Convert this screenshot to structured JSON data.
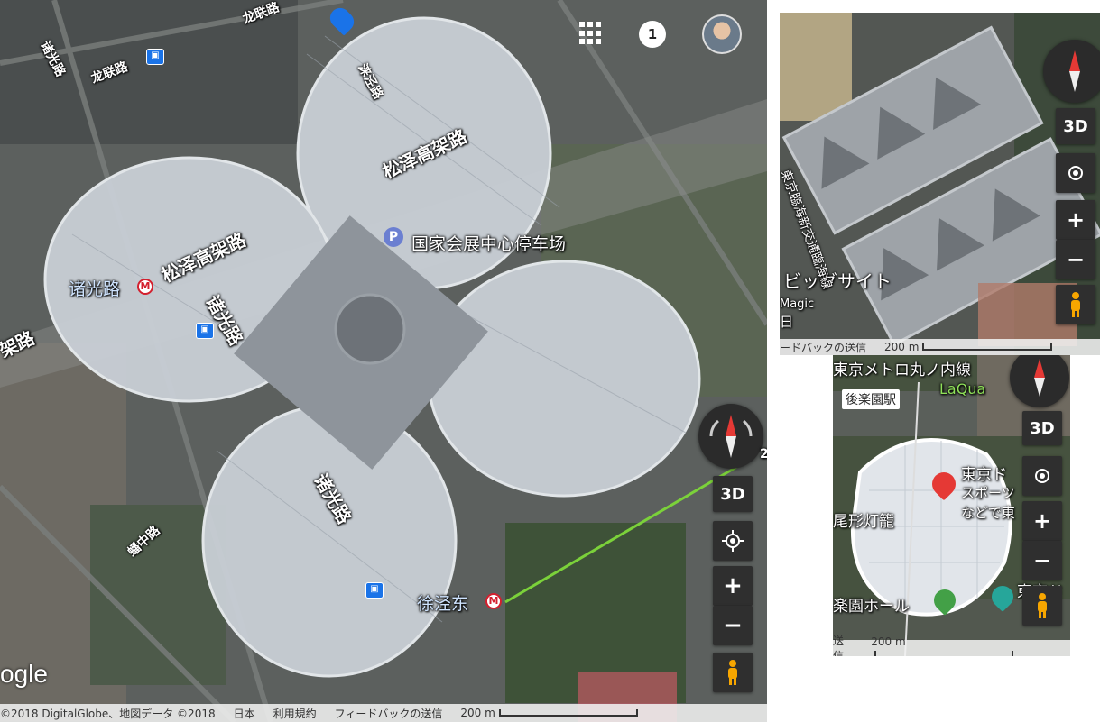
{
  "main": {
    "roads": {
      "songze_1": "松泽高架路",
      "songze_2": "松泽高架路",
      "zhuguang_1": "诸光路",
      "zhuguang_2": "诸光路",
      "zhuguang_3": "诸光路",
      "longlian_1": "龙联路",
      "longlian_2": "龙联路",
      "shenjing": "涞泾路",
      "yingzhong": "蟠中路",
      "jialu": "架路"
    },
    "pois": {
      "parking": "国家会展中心停车场",
      "parking_pin": "P",
      "metro_zhuguang": "诸光路",
      "metro_xujing": "徐泾东"
    },
    "top": {
      "notification_count": "1"
    },
    "controls": {
      "three_d": "3D",
      "zoom_in": "+",
      "zoom_out": "−"
    },
    "edge_label": "2",
    "google_logo": "ogle",
    "footer": {
      "copyright": "©2018 DigitalGlobe、地図データ ©2018",
      "country": "日本",
      "terms": "利用規約",
      "feedback": "フィードバックの送信",
      "scale": "200 m"
    }
  },
  "inset_a": {
    "labels": {
      "big_sight": "ビッグサイト",
      "road_v": "東京臨海新交通臨海線",
      "magic": "Magic",
      "nichi": "日"
    },
    "controls": {
      "three_d": "3D",
      "zoom_in": "+",
      "zoom_out": "−"
    },
    "footer": {
      "feedback": "ードバックの送信",
      "scale": "200 m"
    }
  },
  "inset_b": {
    "labels": {
      "metro_line": "東京メトロ丸ノ内線",
      "laqua": "LaQua",
      "station": "後楽園駅",
      "dome": "東京ド",
      "sports": "スポーツ",
      "nado": "などで東",
      "lantern": "尾形灯籠",
      "hall": "楽園ホール",
      "east": "東京ド"
    },
    "controls": {
      "three_d": "3D",
      "zoom_in": "+",
      "zoom_out": "−"
    },
    "footer": {
      "feedback": "送信",
      "scale": "200 m"
    }
  },
  "colors": {
    "route_green": "#7bd13a",
    "metro_red": "#d3202e",
    "parking_blue": "#6b7fd1",
    "pin_red": "#e53935"
  }
}
